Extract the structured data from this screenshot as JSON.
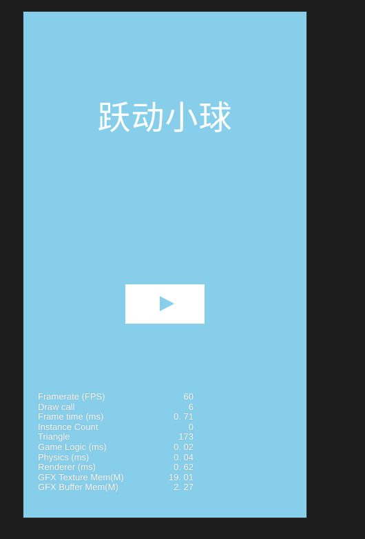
{
  "game": {
    "title": "跃动小球",
    "play_icon": "play-icon",
    "colors": {
      "background": "#87ceeb",
      "button": "#ffffff",
      "text": "#ffffff",
      "outer": "#1d1d1d"
    }
  },
  "stats": [
    {
      "label": "Framerate (FPS)",
      "value": "60"
    },
    {
      "label": "Draw call",
      "value": "6"
    },
    {
      "label": "Frame time (ms)",
      "value": "0. 71"
    },
    {
      "label": "Instance Count",
      "value": "0"
    },
    {
      "label": "Triangle",
      "value": "173"
    },
    {
      "label": "Game Logic (ms)",
      "value": "0. 02"
    },
    {
      "label": "Physics (ms)",
      "value": "0. 04"
    },
    {
      "label": "Renderer (ms)",
      "value": "0. 62"
    },
    {
      "label": "GFX Texture Mem(M)",
      "value": "19. 01"
    },
    {
      "label": "GFX Buffer Mem(M)",
      "value": "2. 27"
    }
  ]
}
